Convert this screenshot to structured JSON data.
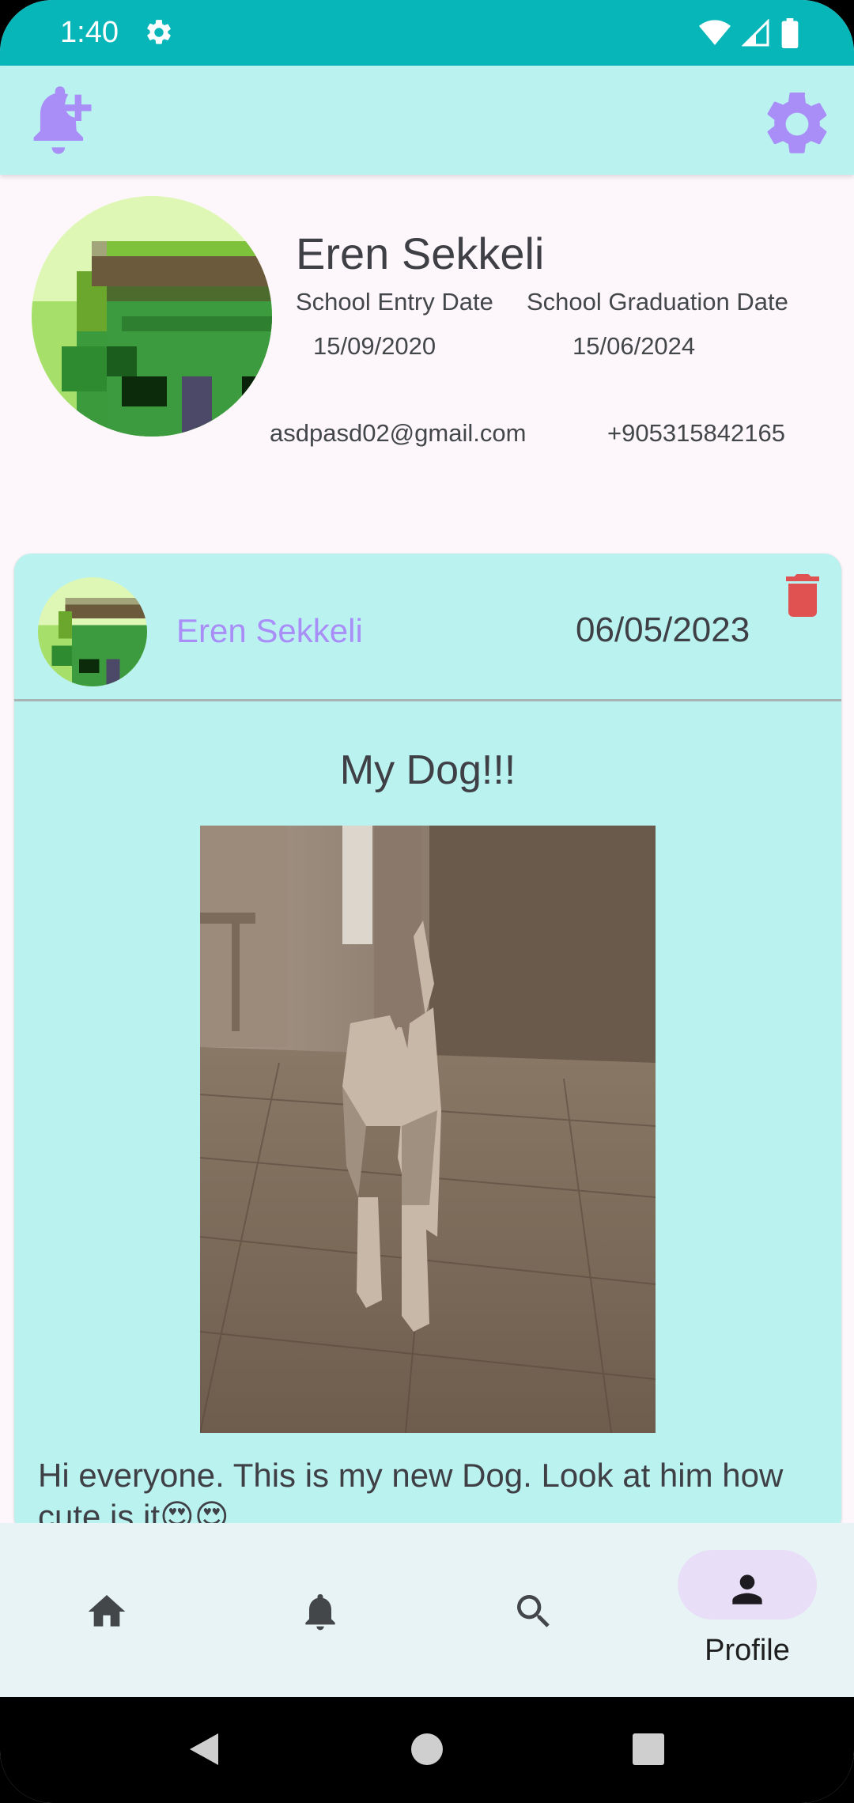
{
  "status_bar": {
    "time": "1:40",
    "icons": [
      "settings-icon",
      "wifi-icon",
      "signal-icon",
      "battery-icon"
    ]
  },
  "top_bar": {
    "left_icon": "notification-add-icon",
    "right_icon": "settings-icon",
    "accent_color": "#a98ef7"
  },
  "profile": {
    "name": "Eren Sekkeli",
    "entry_label": "School Entry Date",
    "entry_date": "15/09/2020",
    "graduation_label": "School Graduation Date",
    "graduation_date": "15/06/2024",
    "email": "asdpasd02@gmail.com",
    "phone": "+905315842165"
  },
  "post": {
    "author": "Eren Sekkeli",
    "date": "06/05/2023",
    "title": "My Dog!!!",
    "body": "Hi everyone. This is my new Dog. Look at him how cute is it😍😍",
    "delete_icon": "trash-icon",
    "delete_color": "#e05252"
  },
  "bottom_nav": {
    "items": [
      {
        "icon": "home-icon",
        "label": ""
      },
      {
        "icon": "bell-icon",
        "label": ""
      },
      {
        "icon": "search-icon",
        "label": ""
      },
      {
        "icon": "person-icon",
        "label": "Profile"
      }
    ],
    "active_index": 3
  }
}
